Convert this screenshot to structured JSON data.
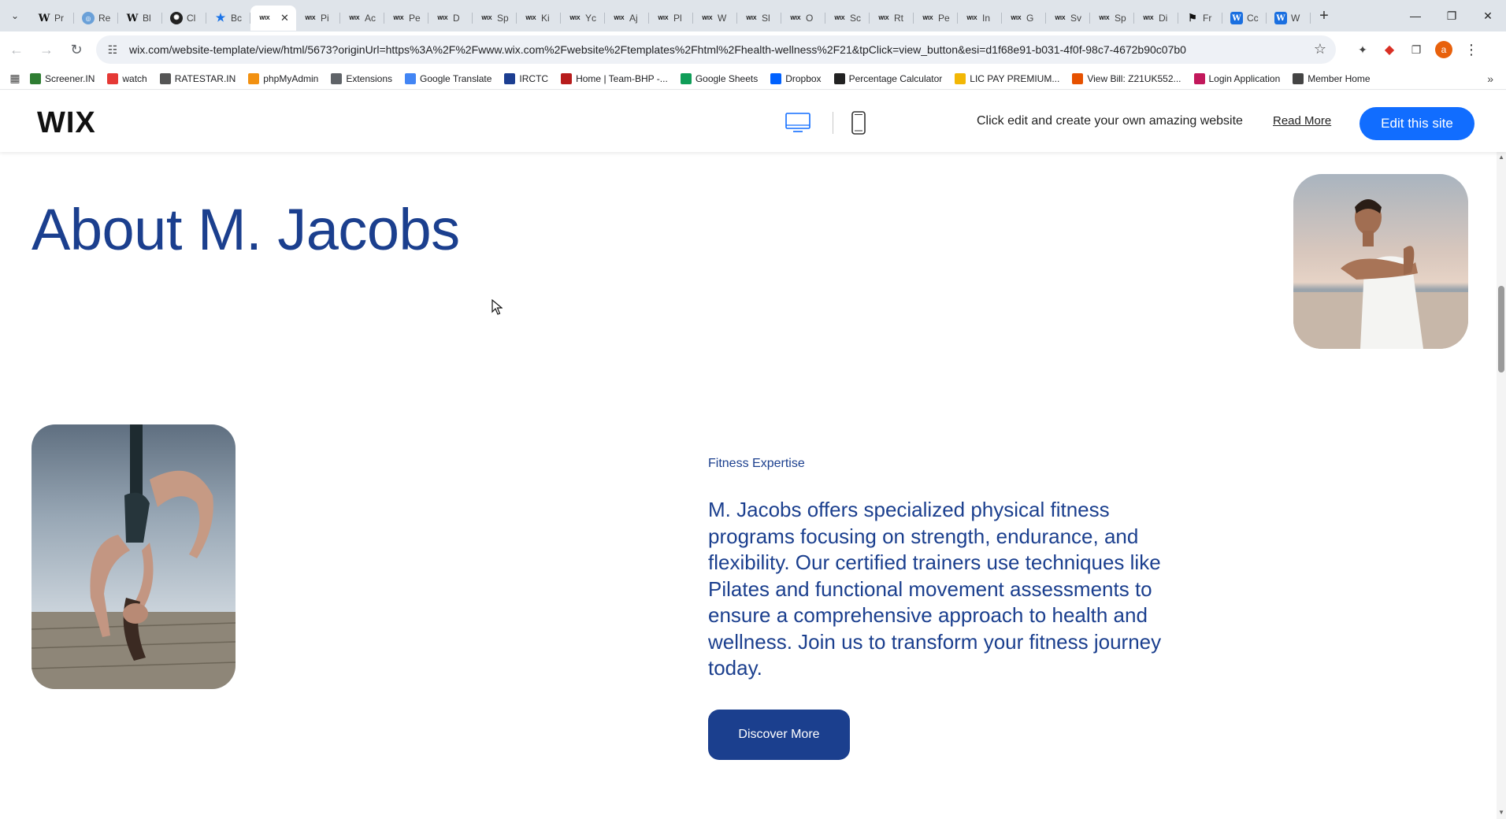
{
  "browser": {
    "tabs": [
      {
        "icon": "wikipedia",
        "label": "Pr"
      },
      {
        "icon": "globe",
        "label": "Re"
      },
      {
        "icon": "wikipedia",
        "label": "Bl"
      },
      {
        "icon": "chatgpt",
        "label": "Cl"
      },
      {
        "icon": "star",
        "label": "Bc"
      },
      {
        "icon": "wix",
        "label": "",
        "active": true
      },
      {
        "icon": "wix",
        "label": "Pi"
      },
      {
        "icon": "wix",
        "label": "Ac"
      },
      {
        "icon": "wix",
        "label": "Pe"
      },
      {
        "icon": "wix",
        "label": "D"
      },
      {
        "icon": "wix",
        "label": "Sp"
      },
      {
        "icon": "wix",
        "label": "Ki"
      },
      {
        "icon": "wix",
        "label": "Yc"
      },
      {
        "icon": "wix",
        "label": "Aj"
      },
      {
        "icon": "wix",
        "label": "Pl"
      },
      {
        "icon": "wix",
        "label": "W"
      },
      {
        "icon": "wix",
        "label": "Sl"
      },
      {
        "icon": "wix",
        "label": "O"
      },
      {
        "icon": "wix",
        "label": "Sc"
      },
      {
        "icon": "wix",
        "label": "Rt"
      },
      {
        "icon": "wix",
        "label": "Pe"
      },
      {
        "icon": "wix",
        "label": "In"
      },
      {
        "icon": "wix",
        "label": "G"
      },
      {
        "icon": "wix",
        "label": "Sv"
      },
      {
        "icon": "wix",
        "label": "Sp"
      },
      {
        "icon": "wix",
        "label": "Di"
      },
      {
        "icon": "f-logo",
        "label": "Fr"
      },
      {
        "icon": "w-blue",
        "label": "Cc"
      },
      {
        "icon": "w-blue",
        "label": "W"
      }
    ],
    "url": "wix.com/website-template/view/html/5673?originUrl=https%3A%2F%2Fwww.wix.com%2Fwebsite%2Ftemplates%2Fhtml%2Fhealth-wellness%2F21&tpClick=view_button&esi=d1f68e91-b031-4f0f-98c7-4672b90c07b0",
    "profile_initial": "a",
    "bookmarks": [
      {
        "label": "Screener.IN",
        "icon_color": "#2e7d32"
      },
      {
        "label": "watch",
        "icon_color": "#e53935"
      },
      {
        "label": "RATESTAR.IN",
        "icon_color": "#555555"
      },
      {
        "label": "phpMyAdmin",
        "icon_color": "#f29111"
      },
      {
        "label": "Extensions",
        "icon_color": "#5f6368"
      },
      {
        "label": "Google Translate",
        "icon_color": "#4285f4"
      },
      {
        "label": "IRCTC",
        "icon_color": "#1c3e91"
      },
      {
        "label": "Home | Team-BHP -...",
        "icon_color": "#b71c1c"
      },
      {
        "label": "Google Sheets",
        "icon_color": "#0f9d58"
      },
      {
        "label": "Dropbox",
        "icon_color": "#0061fe"
      },
      {
        "label": "Percentage Calculator",
        "icon_color": "#222222"
      },
      {
        "label": "LIC PAY PREMIUM...",
        "icon_color": "#f2b705"
      },
      {
        "label": "View Bill: Z21UK552...",
        "icon_color": "#e65100"
      },
      {
        "label": "Login Application",
        "icon_color": "#c2185b"
      },
      {
        "label": "Member Home",
        "icon_color": "#444444"
      }
    ]
  },
  "wix_bar": {
    "logo": "WIX",
    "tagline": "Click edit and create your own amazing website",
    "read_more": "Read More",
    "edit_button": "Edit this site",
    "accent_color": "#116dff"
  },
  "page": {
    "title": "About M. Jacobs",
    "section_label": "Fitness Expertise",
    "body": "M. Jacobs offers specialized physical fitness programs focusing on strength, endurance, and flexibility. Our certified trainers use techniques like Pilates and functional movement assessments to ensure a comprehensive approach to health and wellness. Join us to transform your fitness journey today.",
    "cta": "Discover More",
    "brand_color": "#1b3f8e"
  }
}
